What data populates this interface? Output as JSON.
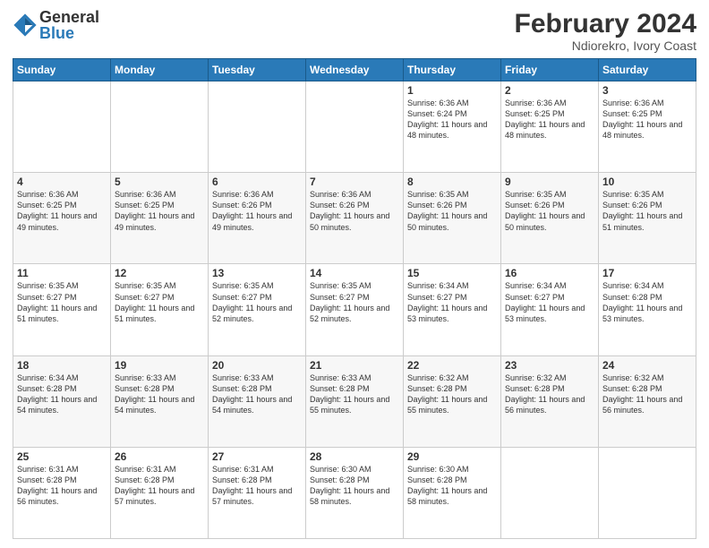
{
  "header": {
    "logo_general": "General",
    "logo_blue": "Blue",
    "month_year": "February 2024",
    "location": "Ndiorekro, Ivory Coast"
  },
  "weekdays": [
    "Sunday",
    "Monday",
    "Tuesday",
    "Wednesday",
    "Thursday",
    "Friday",
    "Saturday"
  ],
  "weeks": [
    [
      {
        "day": "",
        "content": ""
      },
      {
        "day": "",
        "content": ""
      },
      {
        "day": "",
        "content": ""
      },
      {
        "day": "",
        "content": ""
      },
      {
        "day": "1",
        "content": "Sunrise: 6:36 AM\nSunset: 6:24 PM\nDaylight: 11 hours\nand 48 minutes."
      },
      {
        "day": "2",
        "content": "Sunrise: 6:36 AM\nSunset: 6:25 PM\nDaylight: 11 hours\nand 48 minutes."
      },
      {
        "day": "3",
        "content": "Sunrise: 6:36 AM\nSunset: 6:25 PM\nDaylight: 11 hours\nand 48 minutes."
      }
    ],
    [
      {
        "day": "4",
        "content": "Sunrise: 6:36 AM\nSunset: 6:25 PM\nDaylight: 11 hours\nand 49 minutes."
      },
      {
        "day": "5",
        "content": "Sunrise: 6:36 AM\nSunset: 6:25 PM\nDaylight: 11 hours\nand 49 minutes."
      },
      {
        "day": "6",
        "content": "Sunrise: 6:36 AM\nSunset: 6:26 PM\nDaylight: 11 hours\nand 49 minutes."
      },
      {
        "day": "7",
        "content": "Sunrise: 6:36 AM\nSunset: 6:26 PM\nDaylight: 11 hours\nand 50 minutes."
      },
      {
        "day": "8",
        "content": "Sunrise: 6:35 AM\nSunset: 6:26 PM\nDaylight: 11 hours\nand 50 minutes."
      },
      {
        "day": "9",
        "content": "Sunrise: 6:35 AM\nSunset: 6:26 PM\nDaylight: 11 hours\nand 50 minutes."
      },
      {
        "day": "10",
        "content": "Sunrise: 6:35 AM\nSunset: 6:26 PM\nDaylight: 11 hours\nand 51 minutes."
      }
    ],
    [
      {
        "day": "11",
        "content": "Sunrise: 6:35 AM\nSunset: 6:27 PM\nDaylight: 11 hours\nand 51 minutes."
      },
      {
        "day": "12",
        "content": "Sunrise: 6:35 AM\nSunset: 6:27 PM\nDaylight: 11 hours\nand 51 minutes."
      },
      {
        "day": "13",
        "content": "Sunrise: 6:35 AM\nSunset: 6:27 PM\nDaylight: 11 hours\nand 52 minutes."
      },
      {
        "day": "14",
        "content": "Sunrise: 6:35 AM\nSunset: 6:27 PM\nDaylight: 11 hours\nand 52 minutes."
      },
      {
        "day": "15",
        "content": "Sunrise: 6:34 AM\nSunset: 6:27 PM\nDaylight: 11 hours\nand 53 minutes."
      },
      {
        "day": "16",
        "content": "Sunrise: 6:34 AM\nSunset: 6:27 PM\nDaylight: 11 hours\nand 53 minutes."
      },
      {
        "day": "17",
        "content": "Sunrise: 6:34 AM\nSunset: 6:28 PM\nDaylight: 11 hours\nand 53 minutes."
      }
    ],
    [
      {
        "day": "18",
        "content": "Sunrise: 6:34 AM\nSunset: 6:28 PM\nDaylight: 11 hours\nand 54 minutes."
      },
      {
        "day": "19",
        "content": "Sunrise: 6:33 AM\nSunset: 6:28 PM\nDaylight: 11 hours\nand 54 minutes."
      },
      {
        "day": "20",
        "content": "Sunrise: 6:33 AM\nSunset: 6:28 PM\nDaylight: 11 hours\nand 54 minutes."
      },
      {
        "day": "21",
        "content": "Sunrise: 6:33 AM\nSunset: 6:28 PM\nDaylight: 11 hours\nand 55 minutes."
      },
      {
        "day": "22",
        "content": "Sunrise: 6:32 AM\nSunset: 6:28 PM\nDaylight: 11 hours\nand 55 minutes."
      },
      {
        "day": "23",
        "content": "Sunrise: 6:32 AM\nSunset: 6:28 PM\nDaylight: 11 hours\nand 56 minutes."
      },
      {
        "day": "24",
        "content": "Sunrise: 6:32 AM\nSunset: 6:28 PM\nDaylight: 11 hours\nand 56 minutes."
      }
    ],
    [
      {
        "day": "25",
        "content": "Sunrise: 6:31 AM\nSunset: 6:28 PM\nDaylight: 11 hours\nand 56 minutes."
      },
      {
        "day": "26",
        "content": "Sunrise: 6:31 AM\nSunset: 6:28 PM\nDaylight: 11 hours\nand 57 minutes."
      },
      {
        "day": "27",
        "content": "Sunrise: 6:31 AM\nSunset: 6:28 PM\nDaylight: 11 hours\nand 57 minutes."
      },
      {
        "day": "28",
        "content": "Sunrise: 6:30 AM\nSunset: 6:28 PM\nDaylight: 11 hours\nand 58 minutes."
      },
      {
        "day": "29",
        "content": "Sunrise: 6:30 AM\nSunset: 6:28 PM\nDaylight: 11 hours\nand 58 minutes."
      },
      {
        "day": "",
        "content": ""
      },
      {
        "day": "",
        "content": ""
      }
    ]
  ]
}
